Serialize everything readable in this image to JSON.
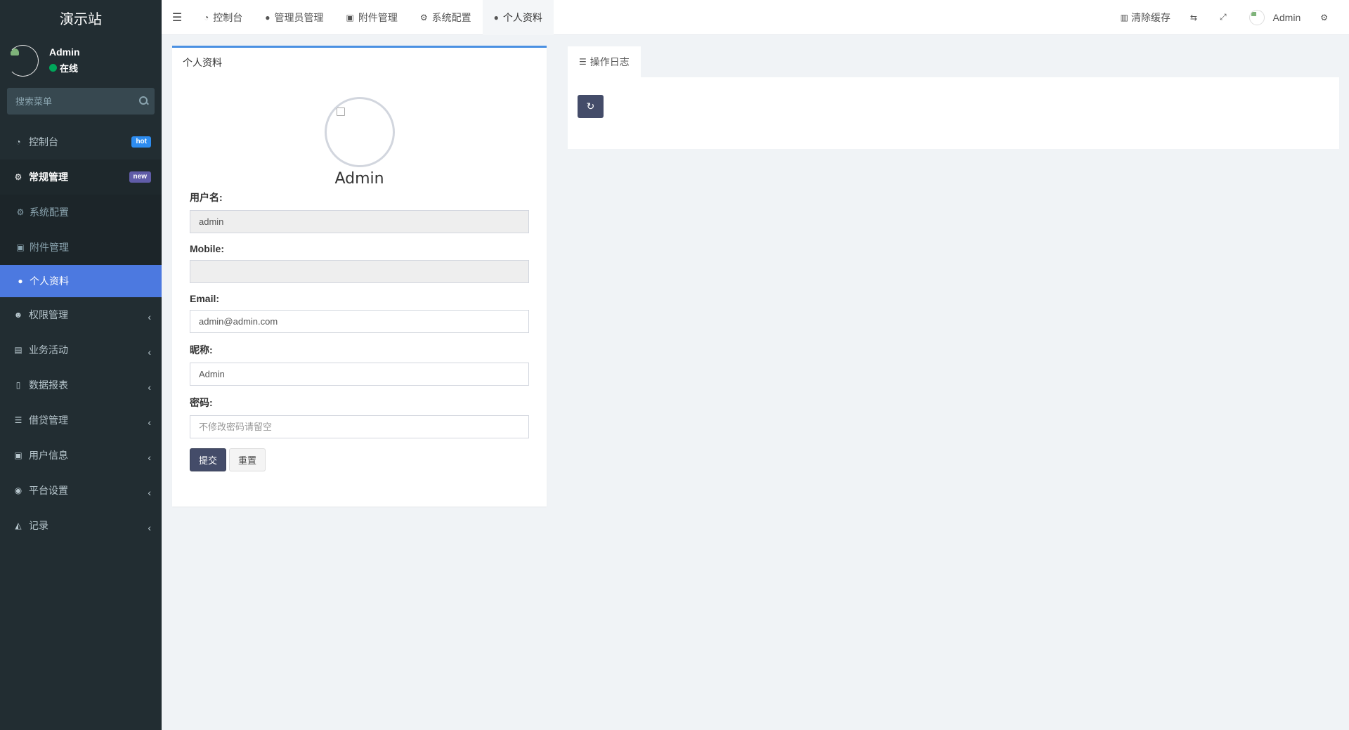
{
  "app": {
    "site_name": "演示站"
  },
  "user_panel": {
    "name": "Admin",
    "status": "在线"
  },
  "sidebar_search": {
    "placeholder": "搜索菜单"
  },
  "menu": {
    "dashboard": {
      "label": "控制台",
      "badge": "hot",
      "icon": "dashboard-icon"
    },
    "general": {
      "label": "常规管理",
      "badge": "new",
      "icon": "cogs-icon"
    },
    "general_sub": [
      {
        "label": "系统配置",
        "icon": "gear-icon"
      },
      {
        "label": "附件管理",
        "icon": "file-image-icon"
      },
      {
        "label": "个人资料",
        "icon": "user-icon"
      }
    ],
    "items": [
      {
        "label": "权限管理",
        "icon": "users-icon"
      },
      {
        "label": "业务活动",
        "icon": "id-card-icon"
      },
      {
        "label": "数据报表",
        "icon": "file-text-icon"
      },
      {
        "label": "借贷管理",
        "icon": "list-icon"
      },
      {
        "label": "用户信息",
        "icon": "address-book-icon"
      },
      {
        "label": "平台设置",
        "icon": "circle-dot-icon"
      },
      {
        "label": "记录",
        "icon": "area-chart-icon"
      }
    ]
  },
  "header": {
    "tabs": [
      {
        "label": "控制台",
        "icon": "dashboard-icon"
      },
      {
        "label": "管理员管理",
        "icon": "user-icon"
      },
      {
        "label": "附件管理",
        "icon": "file-image-icon"
      },
      {
        "label": "系统配置",
        "icon": "gear-icon"
      },
      {
        "label": "个人资料",
        "icon": "user-icon"
      }
    ],
    "clear_cache": "清除缓存",
    "username": "Admin"
  },
  "profile": {
    "panel_title": "个人资料",
    "name": "Admin",
    "fields": {
      "username_label": "用户名:",
      "username_value": "admin",
      "mobile_label": "Mobile:",
      "mobile_value": "",
      "email_label": "Email:",
      "email_value": "admin@admin.com",
      "nickname_label": "昵称:",
      "nickname_value": "Admin",
      "password_label": "密码:",
      "password_placeholder": "不修改密码请留空"
    },
    "submit_label": "提交",
    "reset_label": "重置"
  },
  "log": {
    "tab_label": "操作日志"
  },
  "colors": {
    "sidebar_bg": "#222d32",
    "active_menu": "#4c79e0",
    "primary_btn": "#444c69"
  }
}
